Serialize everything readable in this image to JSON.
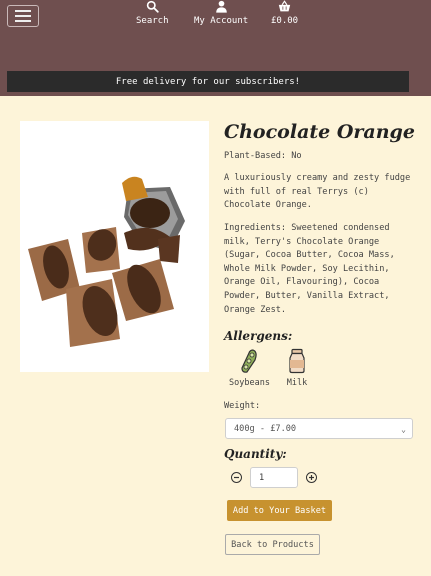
{
  "nav": {
    "search_label": "Search",
    "account_label": "My Account",
    "basket_label": "£0.00"
  },
  "banner": {
    "text": "Free delivery for our subscribers!"
  },
  "product": {
    "title": "Chocolate Orange",
    "plant_based": "Plant-Based: No",
    "description": "A luxuriously creamy and zesty fudge with full of real Terrys (c) Chocolate Orange.",
    "ingredients": "Ingredients: Sweetened condensed milk, Terry's Chocolate Orange (Sugar, Cocoa Butter, Cocoa Mass, Whole Milk Powder, Soy Lecithin, Orange Oil, Flavouring), Cocoa Powder, Butter, Vanilla Extract, Orange Zest."
  },
  "allergens": {
    "heading": "Allergens:",
    "items": [
      {
        "label": "Soybeans",
        "icon": "soybean-icon"
      },
      {
        "label": "Milk",
        "icon": "milk-bottle-icon"
      }
    ]
  },
  "weight": {
    "label": "Weight:",
    "selected": "400g - £7.00"
  },
  "quantity": {
    "heading": "Quantity:",
    "value": "1"
  },
  "buttons": {
    "add": "Add to Your Basket",
    "back": "Back to Products"
  },
  "colors": {
    "header_bg": "#6f4f4f",
    "banner_bg": "#2b2b2b",
    "page_bg": "#fdf4d9",
    "accent": "#c7922f"
  }
}
